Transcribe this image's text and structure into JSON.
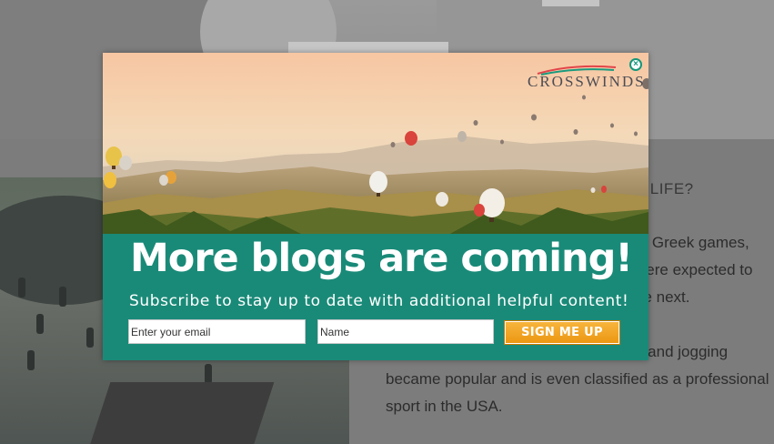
{
  "background_page": {
    "heading_fragment": "Y LIFE?",
    "paragraph1": [
      "nt Greek games,",
      "were expected to",
      "ne next."
    ],
    "paragraph2": [
      "g and jogging",
      "became popular and is even classified as a professional",
      "sport in the USA."
    ]
  },
  "popup": {
    "brand": "CROSSWINDS",
    "close_icon": "close-icon",
    "title": "More blogs are coming!",
    "subtitle": "Subscribe to stay up to date with additional helpful content!",
    "email_placeholder": "Enter your email",
    "name_placeholder": "Name",
    "submit_label": "SIGN ME UP"
  },
  "colors": {
    "banner_teal": "#1a8a78",
    "button_orange": "#f2a524",
    "close_green": "#13977a",
    "overlay_gray": "#8c8c8c"
  }
}
